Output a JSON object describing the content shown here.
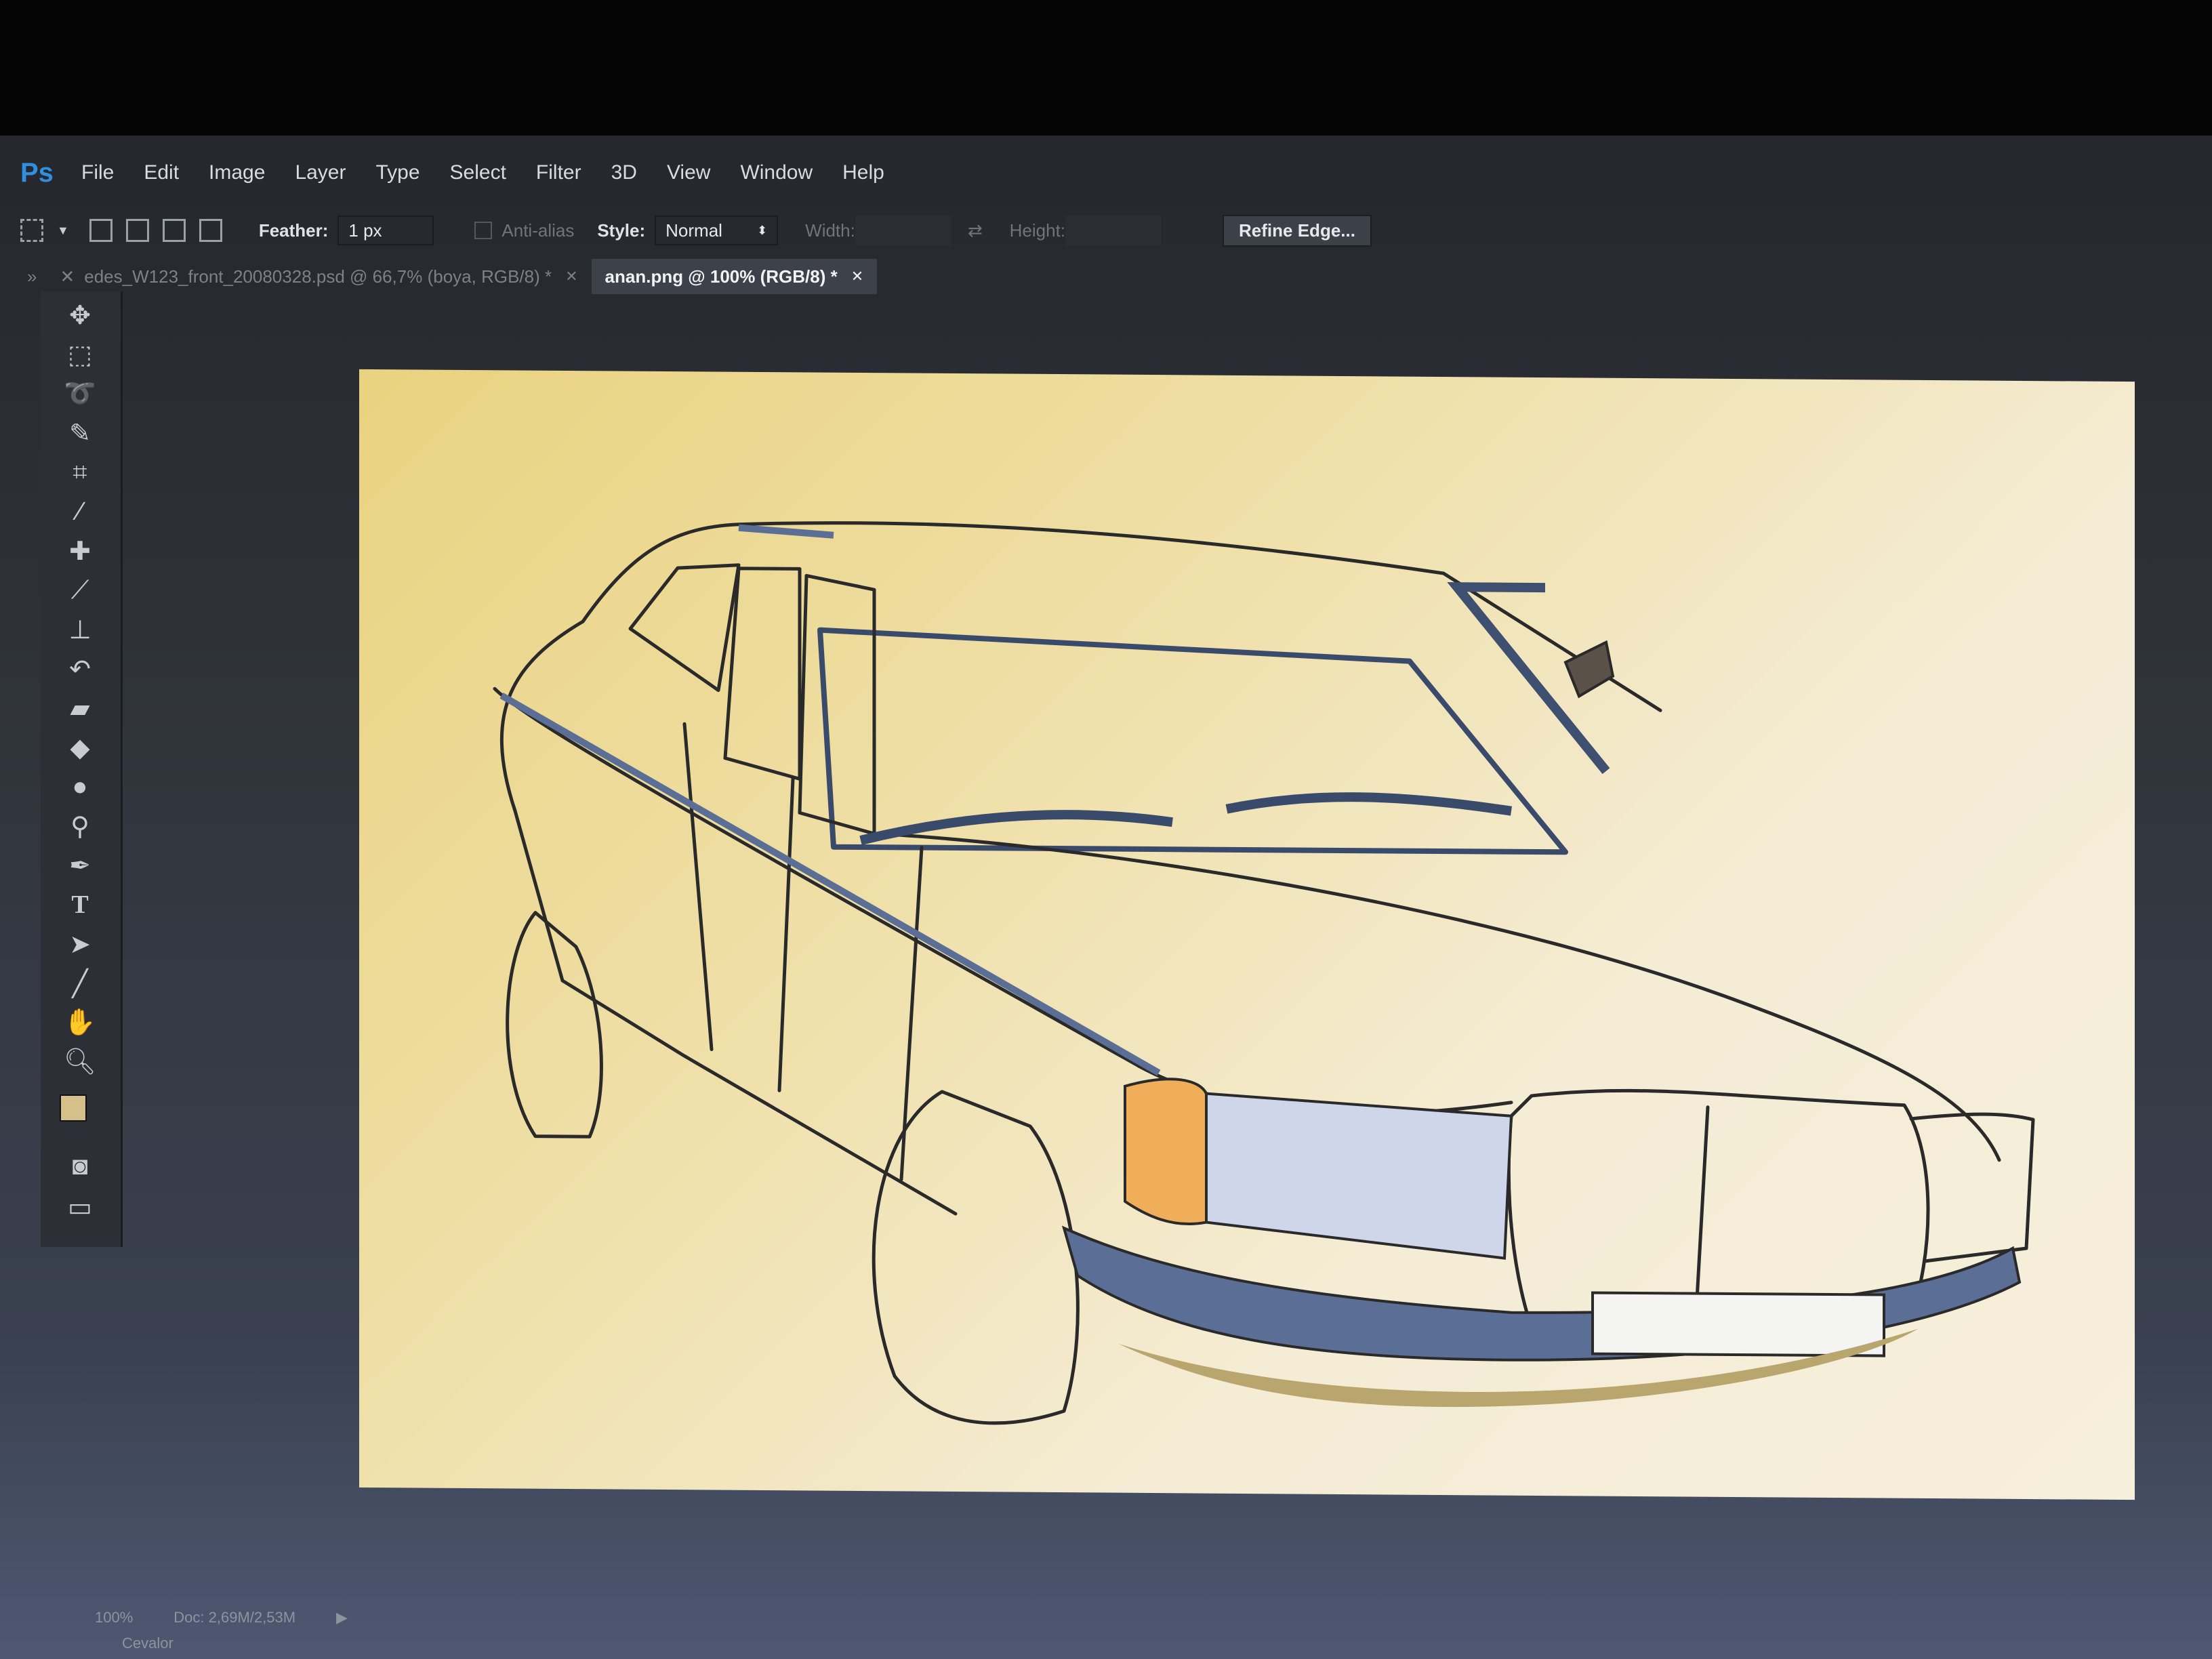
{
  "app": {
    "logo": "Ps"
  },
  "menu": [
    "File",
    "Edit",
    "Image",
    "Layer",
    "Type",
    "Select",
    "Filter",
    "3D",
    "View",
    "Window",
    "Help"
  ],
  "options": {
    "feather_label": "Feather:",
    "feather_value": "1 px",
    "antialias_label": "Anti-alias",
    "style_label": "Style:",
    "style_value": "Normal",
    "width_label": "Width:",
    "height_label": "Height:",
    "refine_button": "Refine Edge..."
  },
  "tabs": [
    {
      "label": "edes_W123_front_20080328.psd @ 66,7% (boya, RGB/8) *",
      "active": false
    },
    {
      "label": "anan.png @ 100% (RGB/8) *",
      "active": true
    }
  ],
  "status": {
    "zoom": "100%",
    "doc": "Doc: 2,69M/2,53M",
    "sub": "Cevalor"
  },
  "colors": {
    "canvas_top": "#e9d27f",
    "canvas_bottom": "#f6efdc",
    "outline": "#2a2a2a",
    "chrome": "#5b6e95",
    "indicator": "#f0ad5a",
    "headlight": "#cfd6ea"
  },
  "tools": [
    "move-icon",
    "marquee-icon",
    "lasso-icon",
    "quick-select-icon",
    "crop-icon",
    "eyedropper-icon",
    "healing-icon",
    "brush-icon",
    "stamp-icon",
    "history-brush-icon",
    "eraser-icon",
    "bucket-icon",
    "blur-icon",
    "dodge-icon",
    "pen-icon",
    "type-icon",
    "path-select-icon",
    "line-icon",
    "hand-icon",
    "zoom-icon",
    "color-swatch-icon",
    "quick-mask-icon",
    "screen-mode-icon"
  ]
}
